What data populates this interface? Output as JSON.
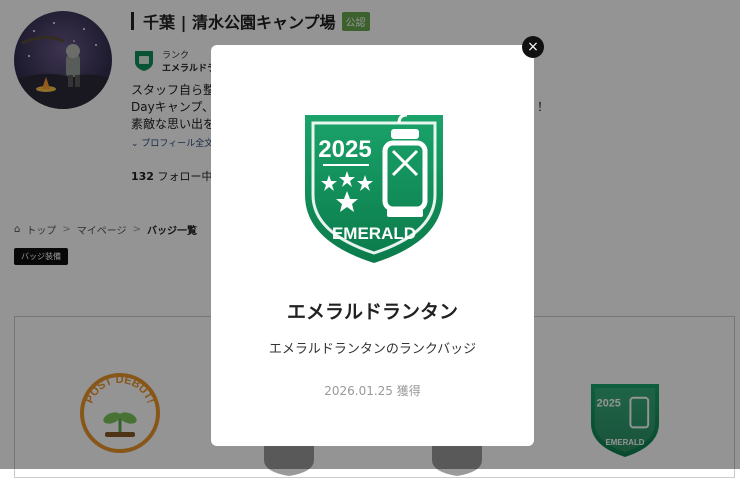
{
  "profile": {
    "name": "千葉 | 清水公園キャンプ場",
    "official_label": "公認",
    "rank_label": "ランク",
    "rank_value": "エメラルドラ",
    "desc_line1": "スタッフ自ら整",
    "desc_line2": "Dayキャンプ、E",
    "desc_line2_end": "！",
    "desc_line3": "素敵な思い出を",
    "more_label": "プロフィール全文",
    "follow_count": "132",
    "follow_label": "フォロー中"
  },
  "breadcrumb": {
    "home": "トップ",
    "mypage": "マイページ",
    "current": "バッジ一覧",
    "separator": ">"
  },
  "badge_equip_label": "バッジ装備",
  "badges": {
    "post_debut_text": "POST DEBUT!",
    "emerald_year": "2025",
    "emerald_text": "EMERALD"
  },
  "modal": {
    "badge_year": "2025",
    "badge_text": "EMERALD",
    "name": "エメラルドランタン",
    "description": "エメラルドランタンのランクバッジ",
    "acquired_date": "2026.01.25 獲得",
    "close_symbol": "×"
  },
  "colors": {
    "emerald_top": "#1aa36a",
    "emerald_bottom": "#0f7f4f",
    "official_green": "#6aa84f",
    "overlay": "rgba(0,0,0,0.42)"
  }
}
